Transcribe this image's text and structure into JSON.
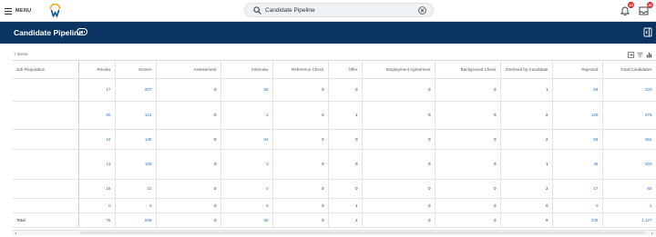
{
  "topbar": {
    "menu_label": "MENU",
    "search_value": "Candidate Pipeline",
    "notifications_badge": "10",
    "inbox_badge": "30"
  },
  "page": {
    "title": "Candidate Pipeline",
    "items_count": "7 items"
  },
  "table": {
    "columns": [
      "Job Requisition",
      "Review",
      "Screen",
      "Assessment",
      "Interview",
      "Reference Check",
      "Offer",
      "Employment Agreement",
      "Background Check",
      "Declined by Candidate",
      "Rejected",
      "Total Candidates"
    ],
    "rows": [
      {
        "req": "",
        "values": [
          "17",
          "207",
          "0",
          "25",
          "0",
          "0",
          "0",
          "0",
          "1",
          "83",
          "333"
        ]
      },
      {
        "req": "",
        "values": [
          "20",
          "122",
          "0",
          "4",
          "0",
          "1",
          "0",
          "0",
          "2",
          "129",
          "278"
        ]
      },
      {
        "req": "",
        "values": [
          "10",
          "148",
          "0",
          "34",
          "0",
          "0",
          "0",
          "0",
          "2",
          "58",
          "252"
        ]
      },
      {
        "req": "",
        "values": [
          "13",
          "138",
          "0",
          "3",
          "0",
          "0",
          "0",
          "0",
          "1",
          "48",
          "203"
        ]
      },
      {
        "req": "",
        "values": [
          "15",
          "31",
          "0",
          "0",
          "0",
          "0",
          "0",
          "0",
          "2",
          "17",
          "60"
        ]
      },
      {
        "req": "",
        "values": [
          "0",
          "0",
          "0",
          "0",
          "0",
          "1",
          "0",
          "0",
          "0",
          "0",
          "1"
        ]
      }
    ],
    "total": {
      "req": "Total",
      "values": [
        "75",
        "646",
        "0",
        "66",
        "0",
        "2",
        "0",
        "0",
        "8",
        "345",
        "1,127"
      ]
    }
  },
  "colors": {
    "header_bg": "#0b3463",
    "link": "#2f6ec4",
    "badge": "#de2e2e"
  }
}
